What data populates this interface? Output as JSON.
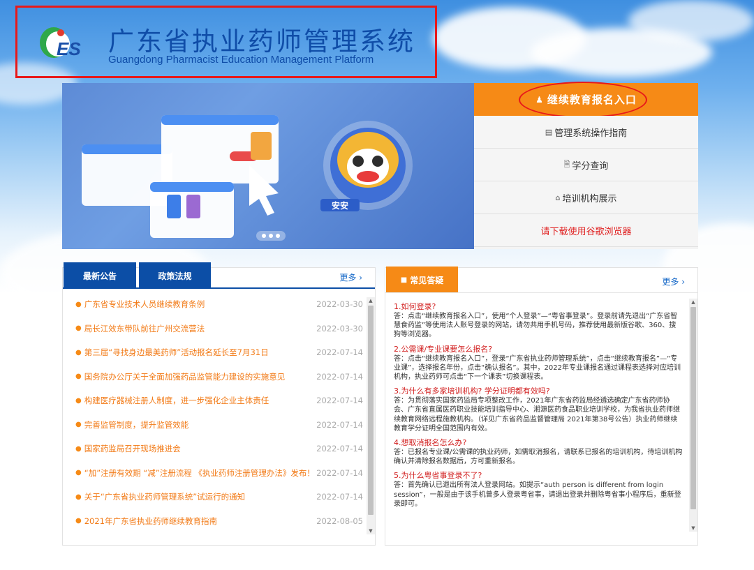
{
  "header": {
    "title": "广东省执业药师管理系统",
    "subtitle": "Guangdong Pharmacist Education Management Platform",
    "logo_text": "ES",
    "mascot_text": "安安"
  },
  "side_menu": {
    "enroll": "继续教育报名入口",
    "items": [
      {
        "label": "管理系统操作指南",
        "icon": "list-icon"
      },
      {
        "label": "学分查询",
        "icon": "document-icon"
      },
      {
        "label": "培训机构展示",
        "icon": "building-icon"
      },
      {
        "label": "请下载使用谷歌浏览器",
        "icon": ""
      }
    ]
  },
  "news": {
    "tabs": [
      "最新公告",
      "政策法规"
    ],
    "more": "更多",
    "items": [
      {
        "title": "广东省专业技术人员继续教育条例",
        "date": "2022-03-30"
      },
      {
        "title": "局长江效东带队前往广州交流营法",
        "date": "2022-03-30"
      },
      {
        "title": "第三届“寻找身边最美药师”活动报名延长至7月31日",
        "date": "2022-07-14"
      },
      {
        "title": "国务院办公厅关于全面加强药品监管能力建设的实施意见",
        "date": "2022-07-14"
      },
      {
        "title": "构建医疗器械注册人制度，进一步强化企业主体责任",
        "date": "2022-07-14"
      },
      {
        "title": "完善监管制度，提升监管效能",
        "date": "2022-07-14"
      },
      {
        "title": "国家药监局召开现场推进会",
        "date": "2022-07-14"
      },
      {
        "title": "“加”注册有效期 “减”注册流程 《执业药师注册管理办法》发布！",
        "date": "2022-07-14"
      },
      {
        "title": "关于“广东省执业药师管理系统”试运行的通知",
        "date": "2022-07-14"
      },
      {
        "title": "2021年广东省执业药师继续教育指南",
        "date": "2022-08-05"
      }
    ]
  },
  "faq": {
    "tab": "常见答疑",
    "more": "更多",
    "items": [
      {
        "q": "1.如何登录?",
        "a": "答：点击“继续教育报名入口”，使用“个人登录”—“粤省事登录”。登录前请先退出“广东省智慧食药监”等使用法人账号登录的网站，请勿共用手机号码，推荐使用最新版谷歌、360、搜狗等浏览器。"
      },
      {
        "q": "2.公需课/专业课要怎么报名?",
        "a": "答：点击“继续教育报名入口”，登录“广东省执业药师管理系统”，点击“继续教育报名”—“专业课”，选择报名年份，点击“确认报名”。其中，2022年专业课报名通过课程表选择对应培训机构，执业药师可点击“下一个课表”切换课程表。"
      },
      {
        "q": "3.为什么有多家培训机构? 学分证明都有效吗?",
        "a": "答：为贯彻落实国家药监局专项整改工作，2021年广东省药监局经遴选确定广东省药师协会、广东省直属医药职业技能培训指导中心、湘源医药食品职业培训学校，为我省执业药师继续教育网络远程施教机构。（详见广东省药品监督管理局 2021年第38号公告）执业药师继续教育学分证明全国范围内有效。"
      },
      {
        "q": "4.想取消报名怎么办?",
        "a": "答：已报名专业课/公需课的执业药师，如需取消报名，请联系已报名的培训机构，待培训机构确认并清除报名数据后，方可重新报名。"
      },
      {
        "q": "5.为什么粤省事登录不了?",
        "a": "答：首先确认已退出所有法人登录网站。如提示“auth person is different from login session”，一般是由于该手机曾多人登录粤省事，请退出登录并删除粤省事小程序后，重新登录即可。"
      }
    ]
  },
  "colors": {
    "brand_blue": "#0c4ea6",
    "accent_orange": "#f68a16",
    "highlight_red": "#e8191a"
  }
}
